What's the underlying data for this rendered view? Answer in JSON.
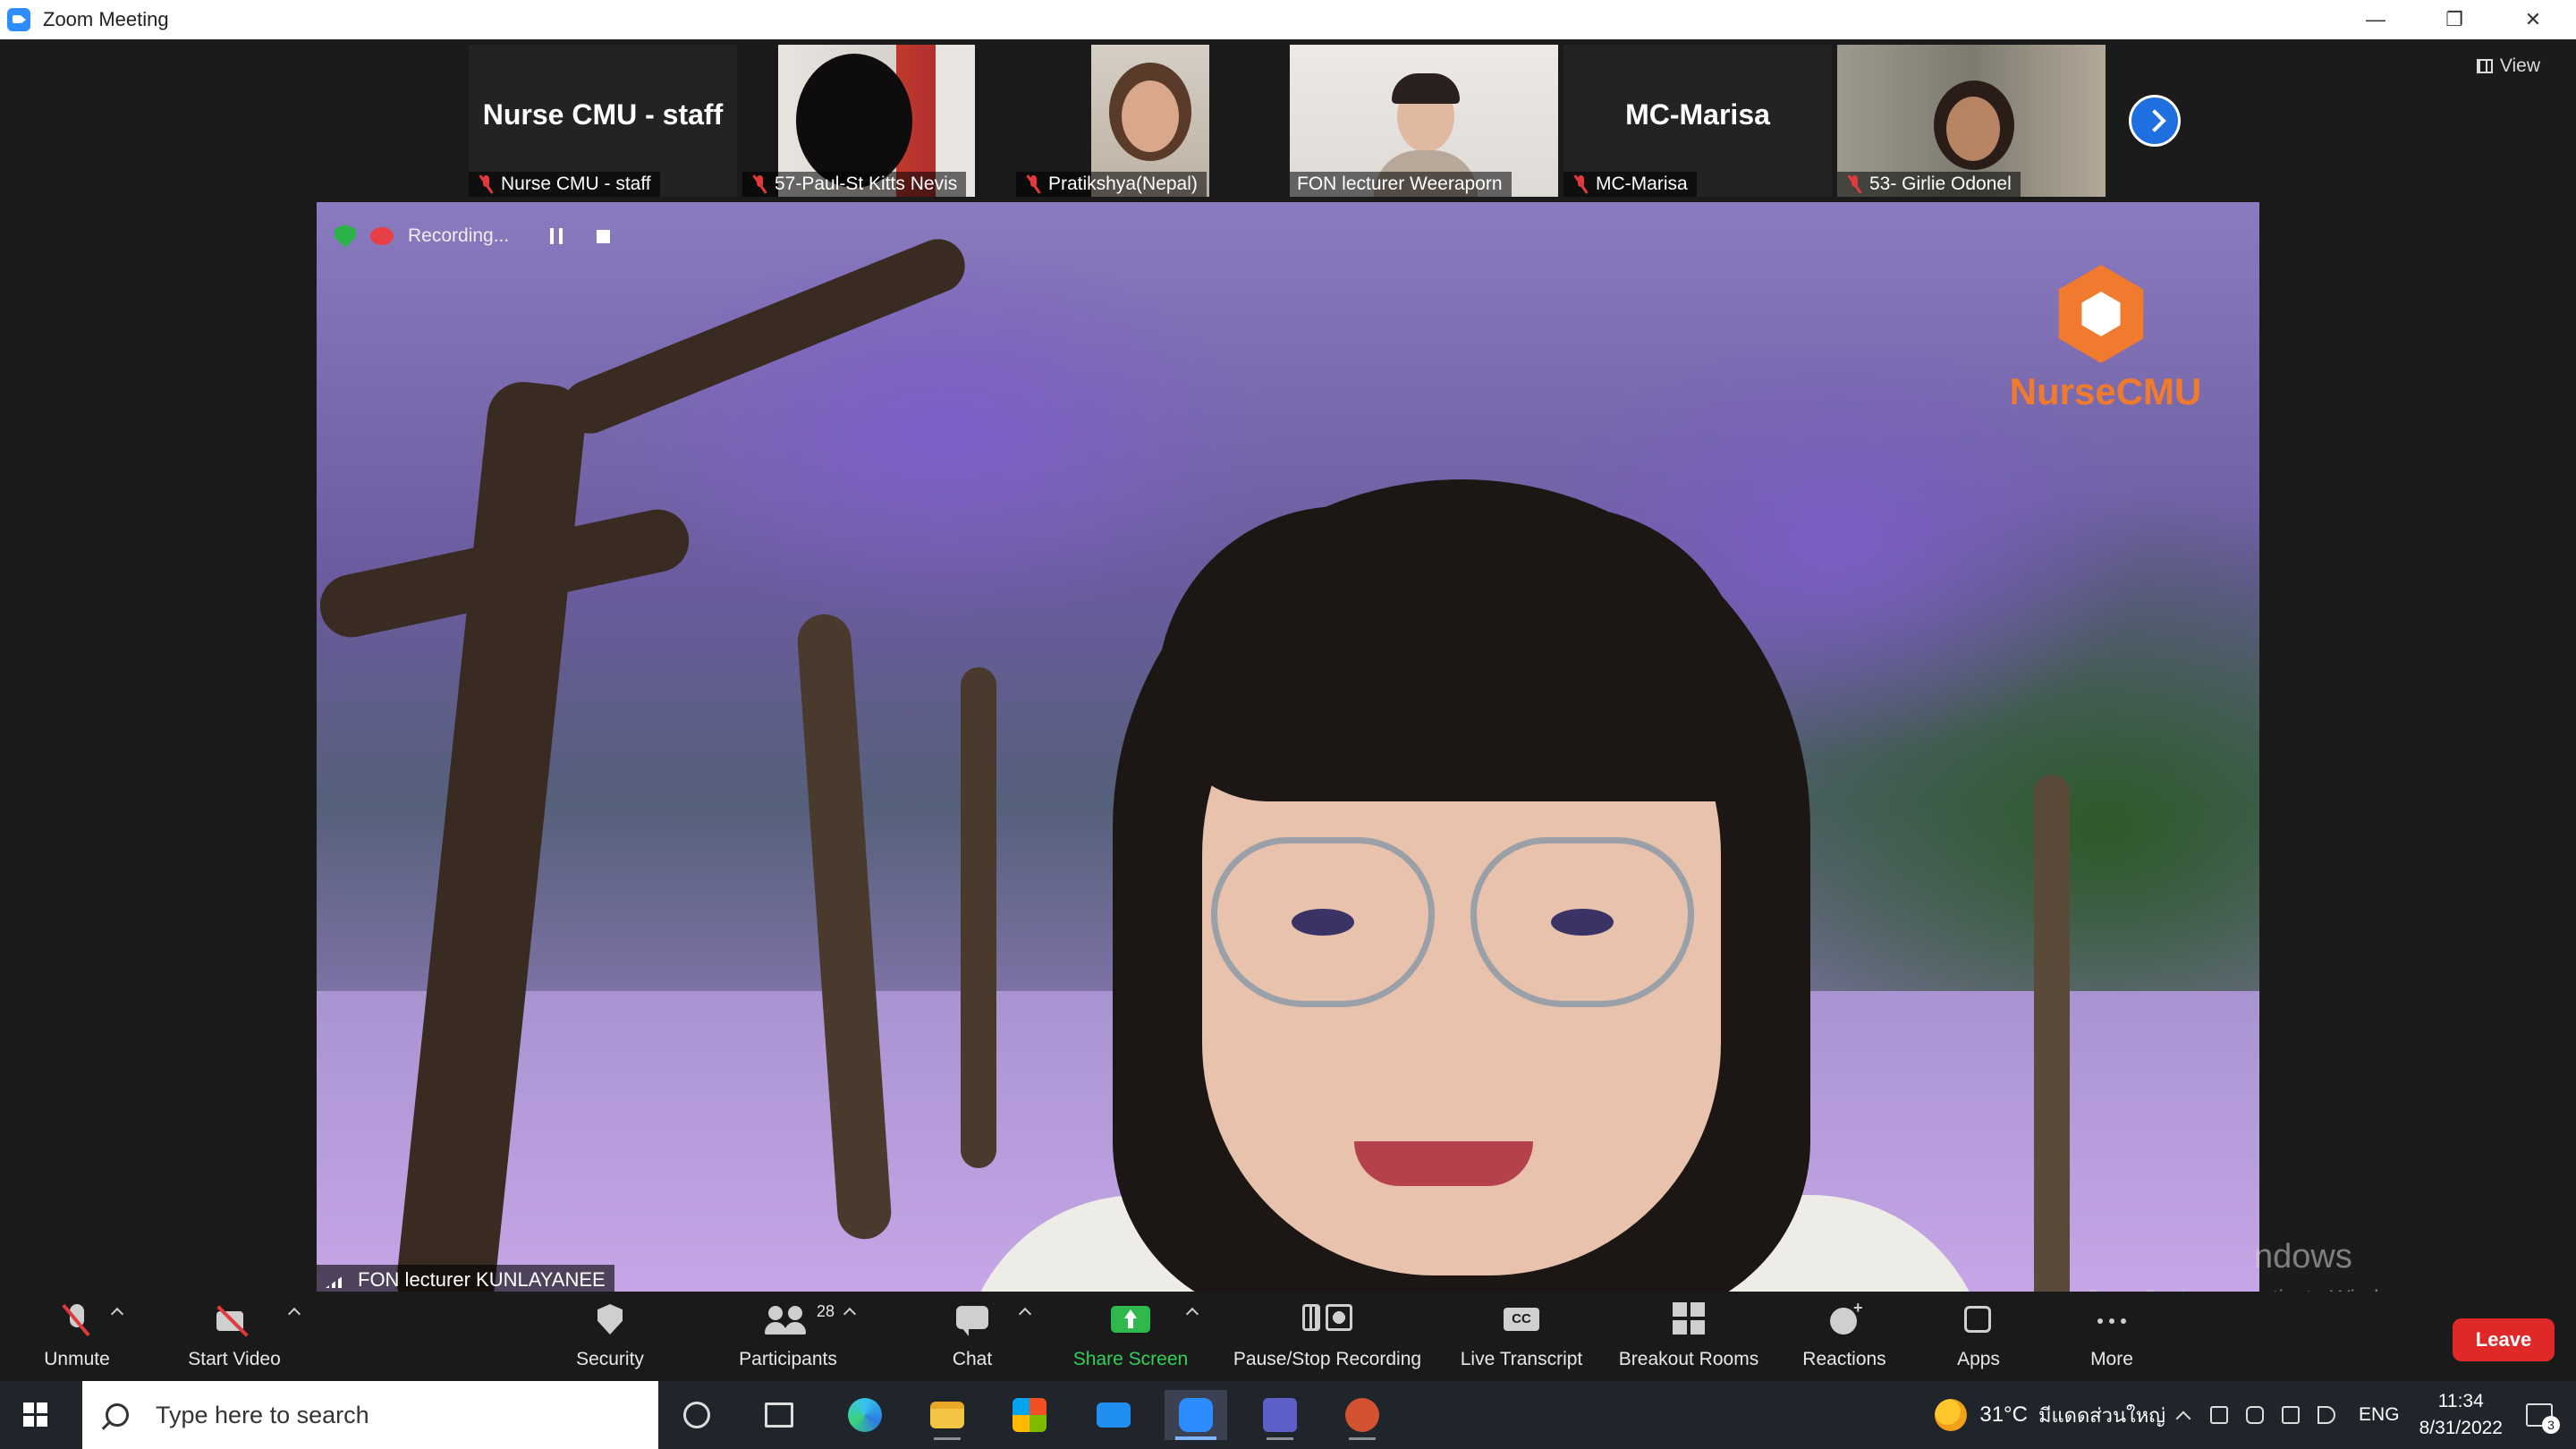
{
  "window": {
    "title": "Zoom Meeting",
    "controls": {
      "minimize": "—",
      "restore": "❐",
      "close": "✕"
    }
  },
  "view_button": {
    "label": "View"
  },
  "thumbnails": [
    {
      "name": "Nurse CMU - staff",
      "display": "Nurse CMU - staff",
      "muted": true,
      "video": false
    },
    {
      "name": "57-Paul-St Kitts Nevis",
      "muted": true,
      "video": true
    },
    {
      "name": "Pratikshya(Nepal)",
      "muted": true,
      "video": true
    },
    {
      "name": "FON lecturer Weeraporn",
      "muted": false,
      "video": true
    },
    {
      "name": "MC-Marisa",
      "display": "MC-Marisa",
      "muted": true,
      "video": false
    },
    {
      "name": "53- Girlie Odonel",
      "muted": true,
      "video": true
    }
  ],
  "recording": {
    "status": "Recording..."
  },
  "logo": {
    "text": "NurseCMU"
  },
  "speaker": {
    "name": "FON lecturer KUNLAYANEE"
  },
  "watermark": {
    "title": "ndows",
    "subtitle": "Go to Settings to activate Windows."
  },
  "toolbar": {
    "unmute": "Unmute",
    "start_video": "Start Video",
    "security": "Security",
    "participants": "Participants",
    "participants_count": "28",
    "chat": "Chat",
    "share_screen": "Share Screen",
    "pause_stop_recording": "Pause/Stop Recording",
    "live_transcript": "Live Transcript",
    "breakout_rooms": "Breakout Rooms",
    "reactions": "Reactions",
    "apps": "Apps",
    "more": "More",
    "leave": "Leave"
  },
  "taskbar": {
    "search_placeholder": "Type here to search",
    "weather": "31°C",
    "weather_desc": "มีแดดส่วนใหญ่",
    "language": "ENG",
    "time": "11:34",
    "date": "8/31/2022",
    "notification_count": "3"
  },
  "colors": {
    "accent_blue": "#2d8cff",
    "share_green": "#2fb84b",
    "leave_red": "#e02828",
    "logo_orange": "#f07a2e"
  }
}
